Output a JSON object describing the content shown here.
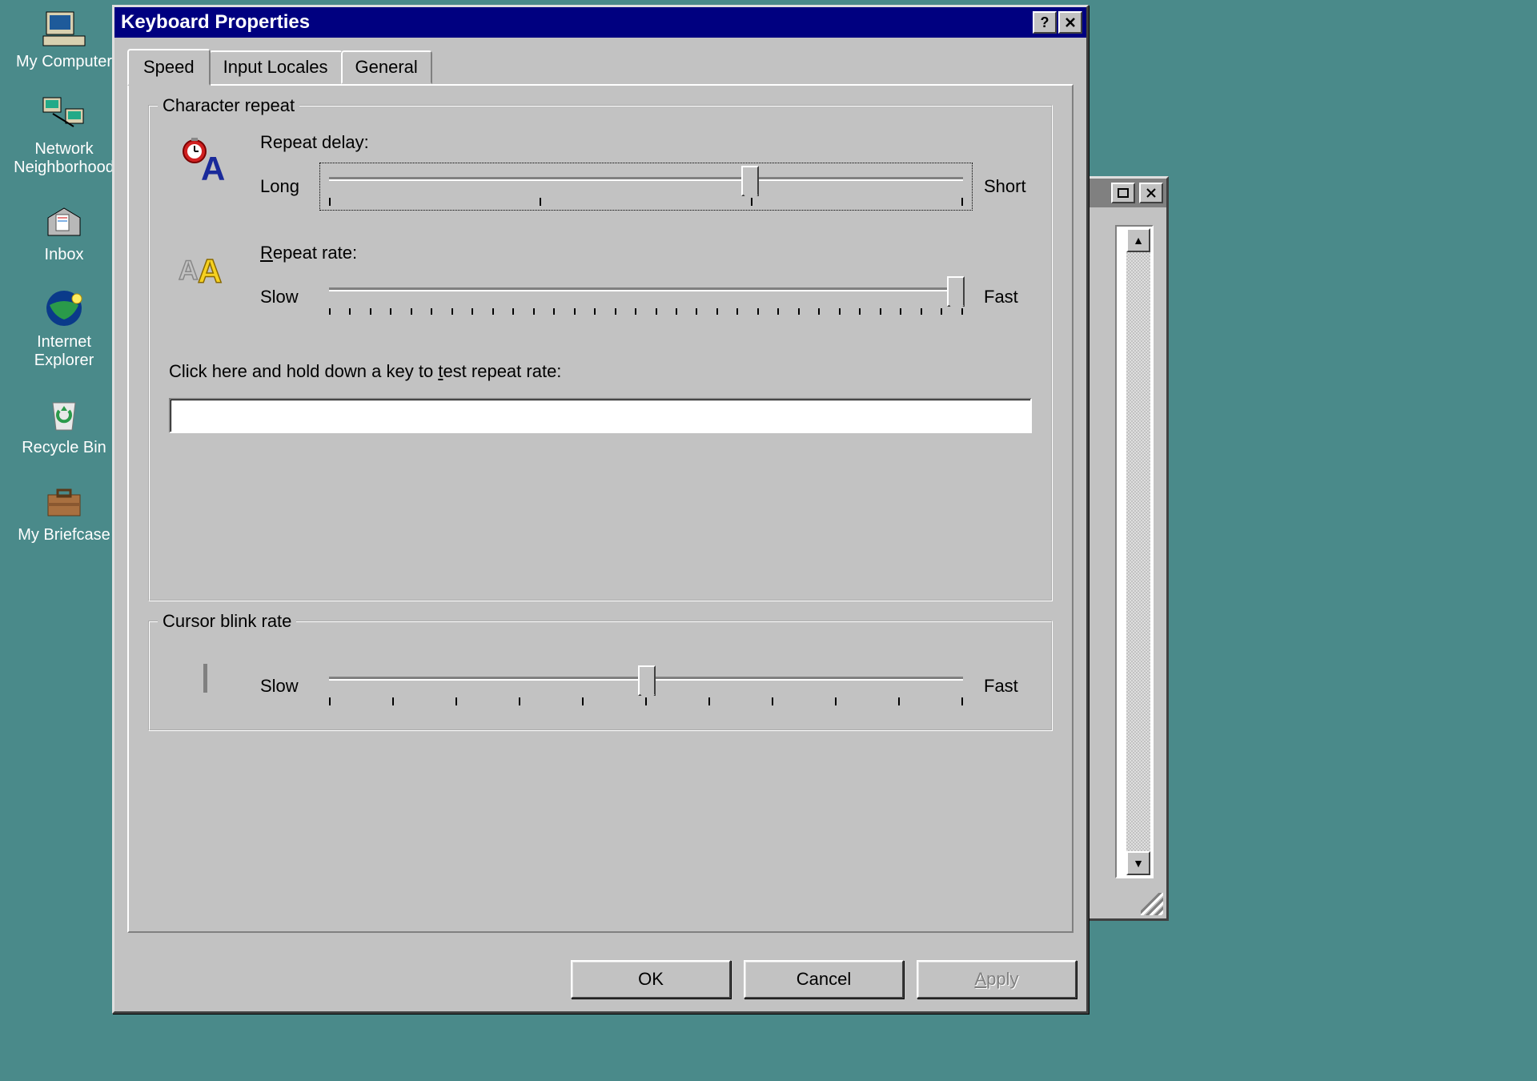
{
  "desktop": {
    "icons": [
      {
        "label": "My Computer",
        "icon": "computer-icon"
      },
      {
        "label": "Network Neighborhood",
        "icon": "network-icon"
      },
      {
        "label": "Inbox",
        "icon": "inbox-icon"
      },
      {
        "label": "Internet Explorer",
        "icon": "globe-icon"
      },
      {
        "label": "Recycle Bin",
        "icon": "recycle-icon"
      },
      {
        "label": "My Briefcase",
        "icon": "briefcase-icon"
      }
    ]
  },
  "dialog": {
    "title": "Keyboard Properties",
    "tabs": [
      "Speed",
      "Input Locales",
      "General"
    ],
    "active_tab": "Speed",
    "group1": {
      "legend": "Character repeat",
      "delay": {
        "label": "Repeat delay:",
        "left": "Long",
        "right": "Short",
        "steps": 4,
        "value": 2
      },
      "rate": {
        "label": "Repeat rate:",
        "left": "Slow",
        "right": "Fast",
        "steps": 32,
        "value": 31
      },
      "test_label": "Click here and hold down a key to test repeat rate:",
      "test_value": ""
    },
    "group2": {
      "legend": "Cursor blink rate",
      "left": "Slow",
      "right": "Fast",
      "steps": 11,
      "value": 5
    },
    "buttons": {
      "ok": "OK",
      "cancel": "Cancel",
      "apply": "Apply"
    }
  }
}
